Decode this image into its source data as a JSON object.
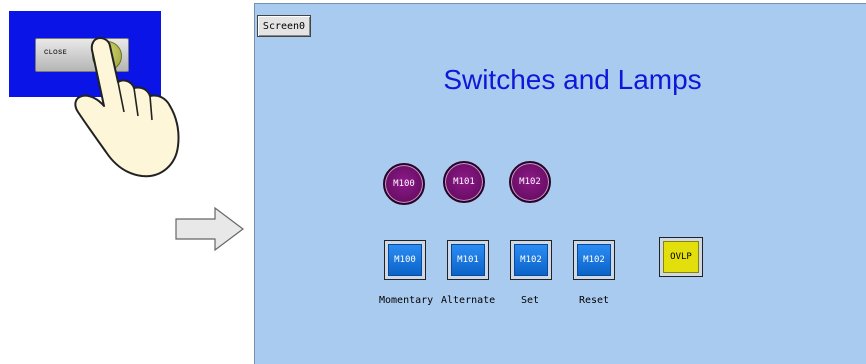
{
  "illustration": {
    "close_button_label": "CLOSE"
  },
  "hmi": {
    "screen_tab": "Screen0",
    "title": "Switches and Lamps",
    "lamps": [
      {
        "label": "M100"
      },
      {
        "label": "M101"
      },
      {
        "label": "M102"
      }
    ],
    "switches": [
      {
        "label": "M100",
        "caption": "Momentary"
      },
      {
        "label": "M101",
        "caption": "Alternate"
      },
      {
        "label": "M102",
        "caption": "Set"
      },
      {
        "label": "M102",
        "caption": "Reset"
      }
    ],
    "ovlp_label": "OVLP"
  },
  "colors": {
    "screen_bg": "#aacbf0",
    "title": "#0d18d8",
    "lamp": "#7a137a",
    "switch": "#1a78e4",
    "ovlp": "#e2df0c",
    "panel": "#0a14e6"
  }
}
